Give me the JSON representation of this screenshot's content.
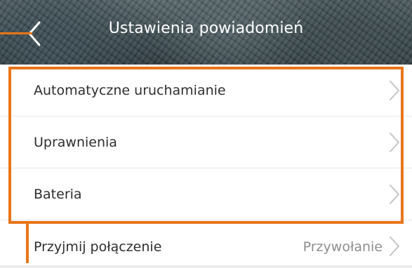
{
  "header": {
    "title": "Ustawienia powiadomień",
    "back_icon": "chevron-left-icon"
  },
  "list": {
    "items": [
      {
        "label": "Automatyczne uruchamianie",
        "value": "",
        "icon": "chevron-right-icon"
      },
      {
        "label": "Uprawnienia",
        "value": "",
        "icon": "chevron-right-icon"
      },
      {
        "label": "Bateria",
        "value": "",
        "icon": "chevron-right-icon"
      },
      {
        "label": "Przyjmij połączenie",
        "value": "Przywołanie",
        "icon": "chevron-right-icon"
      }
    ]
  },
  "colors": {
    "highlight": "#e8761a",
    "background": "#ececec",
    "row_background": "#ffffff",
    "label_text": "#2e2e2e",
    "value_text": "#8e8e8e",
    "chevron": "#c4c4c4"
  }
}
